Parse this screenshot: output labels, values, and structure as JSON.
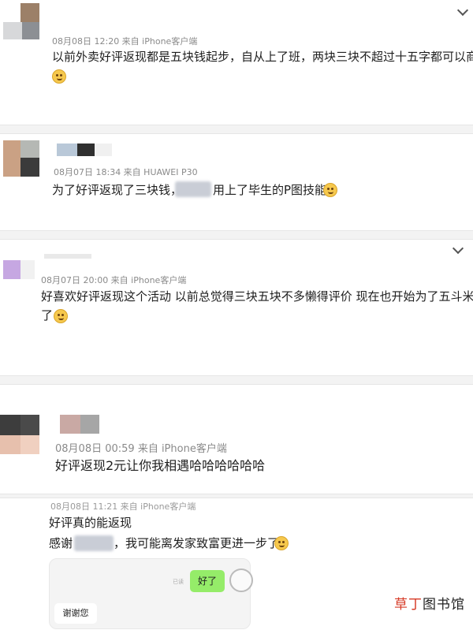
{
  "comments": [
    {
      "meta": "08月08日 12:20  来自 iPhone客户端",
      "text": "以前外卖好评返现都是五块钱起步，自从上了班，两块三块不超过十五字都可以商量。"
    },
    {
      "meta": "08月07日 18:34  来自 HUAWEI P30",
      "text_before": "为了好评返现了三块钱，",
      "text_after": "用上了毕生的P图技能"
    },
    {
      "meta": "08月07日 20:00  来自 iPhone客户端",
      "text_line1": "好喜欢好评返现这个活动 以前总觉得三块五块不多懒得评价 现在也开始为了五斗米折腰",
      "text_line2": "了"
    },
    {
      "meta": "08月08日  00:59  来自 iPhone客户端",
      "text": "好评返现2元让你我相遇哈哈哈哈哈哈"
    },
    {
      "meta": "08月08日  11:21  来自 iPhone客户端",
      "text_line1": "好评真的能返现",
      "text_line2_before": "感谢",
      "text_line2_after": "，我可能离发家致富更进一步了"
    }
  ],
  "chat_screenshot": {
    "read_tag": "已读",
    "green_bubble": "好了",
    "white_bubble": "谢谢您"
  },
  "watermark": {
    "red": "草丁",
    "black": "图书馆"
  }
}
